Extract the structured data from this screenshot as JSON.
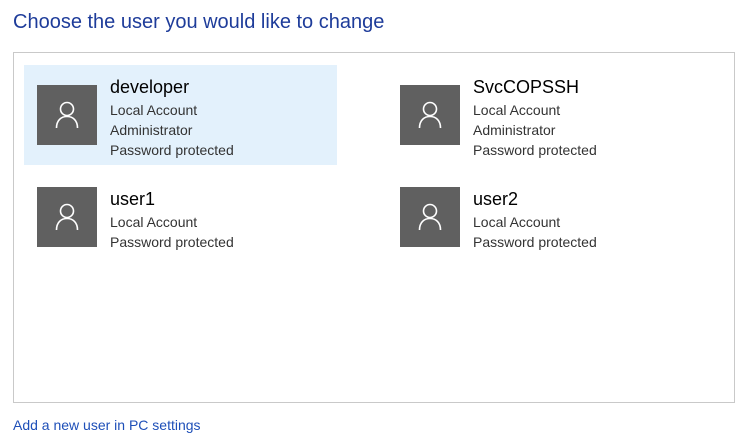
{
  "page": {
    "title": "Choose the user you would like to change"
  },
  "users": [
    {
      "name": "developer",
      "details": [
        "Local Account",
        "Administrator",
        "Password protected"
      ],
      "selected": true
    },
    {
      "name": "SvcCOPSSH",
      "details": [
        "Local Account",
        "Administrator",
        "Password protected"
      ],
      "selected": false
    },
    {
      "name": "user1",
      "details": [
        "Local Account",
        "Password protected"
      ],
      "selected": false
    },
    {
      "name": "user2",
      "details": [
        "Local Account",
        "Password protected"
      ],
      "selected": false
    }
  ],
  "footer": {
    "add_user_link": "Add a new user in PC settings"
  },
  "colors": {
    "title": "#1e3c9a",
    "link": "#1e4fb8",
    "selected_tile": "#e3f1fc",
    "avatar_bg": "#606060",
    "panel_border": "#c9c9c9"
  },
  "icons": {
    "avatar": "user-silhouette-icon"
  }
}
